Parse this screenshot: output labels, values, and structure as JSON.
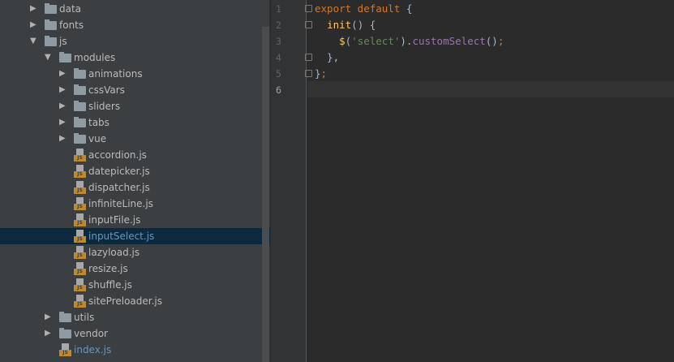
{
  "tree": [
    {
      "label": "data",
      "type": "folder",
      "level": 0,
      "state": "collapsed"
    },
    {
      "label": "fonts",
      "type": "folder",
      "level": 0,
      "state": "collapsed"
    },
    {
      "label": "js",
      "type": "folder",
      "level": 0,
      "state": "expanded"
    },
    {
      "label": "modules",
      "type": "folder",
      "level": 1,
      "state": "expanded"
    },
    {
      "label": "animations",
      "type": "folder",
      "level": 2,
      "state": "collapsed"
    },
    {
      "label": "cssVars",
      "type": "folder",
      "level": 2,
      "state": "collapsed"
    },
    {
      "label": "sliders",
      "type": "folder",
      "level": 2,
      "state": "collapsed"
    },
    {
      "label": "tabs",
      "type": "folder",
      "level": 2,
      "state": "collapsed"
    },
    {
      "label": "vue",
      "type": "folder",
      "level": 2,
      "state": "collapsed"
    },
    {
      "label": "accordion.js",
      "type": "file",
      "level": 2
    },
    {
      "label": "datepicker.js",
      "type": "file",
      "level": 2
    },
    {
      "label": "dispatcher.js",
      "type": "file",
      "level": 2
    },
    {
      "label": "infiniteLine.js",
      "type": "file",
      "level": 2
    },
    {
      "label": "inputFile.js",
      "type": "file",
      "level": 2
    },
    {
      "label": "inputSelect.js",
      "type": "file",
      "level": 2,
      "selected": true
    },
    {
      "label": "lazyload.js",
      "type": "file",
      "level": 2
    },
    {
      "label": "resize.js",
      "type": "file",
      "level": 2
    },
    {
      "label": "shuffle.js",
      "type": "file",
      "level": 2
    },
    {
      "label": "sitePreloader.js",
      "type": "file",
      "level": 2
    },
    {
      "label": "utils",
      "type": "folder",
      "level": 1,
      "state": "collapsed"
    },
    {
      "label": "vendor",
      "type": "folder",
      "level": 1,
      "state": "collapsed"
    },
    {
      "label": "index.js",
      "type": "file",
      "level": 1,
      "modified": true
    }
  ],
  "js_badge": "JS",
  "editor": {
    "line_numbers": [
      "1",
      "2",
      "3",
      "4",
      "5",
      "6"
    ],
    "current_line": 6,
    "lines": [
      [
        {
          "t": "export default ",
          "c": "kw"
        },
        {
          "t": "{",
          "c": ""
        }
      ],
      [
        {
          "t": "  ",
          "c": ""
        },
        {
          "t": "init",
          "c": "fn"
        },
        {
          "t": "() {",
          "c": ""
        }
      ],
      [
        {
          "t": "    ",
          "c": ""
        },
        {
          "t": "$",
          "c": "fn"
        },
        {
          "t": "(",
          "c": ""
        },
        {
          "t": "'select'",
          "c": "str"
        },
        {
          "t": ").",
          "c": ""
        },
        {
          "t": "customSelect",
          "c": "mth"
        },
        {
          "t": "()",
          "c": ""
        },
        {
          "t": ";",
          "c": "kw"
        }
      ],
      [
        {
          "t": "  },",
          "c": ""
        }
      ],
      [
        {
          "t": "}",
          "c": ""
        },
        {
          "t": ";",
          "c": "kw"
        }
      ],
      []
    ]
  }
}
